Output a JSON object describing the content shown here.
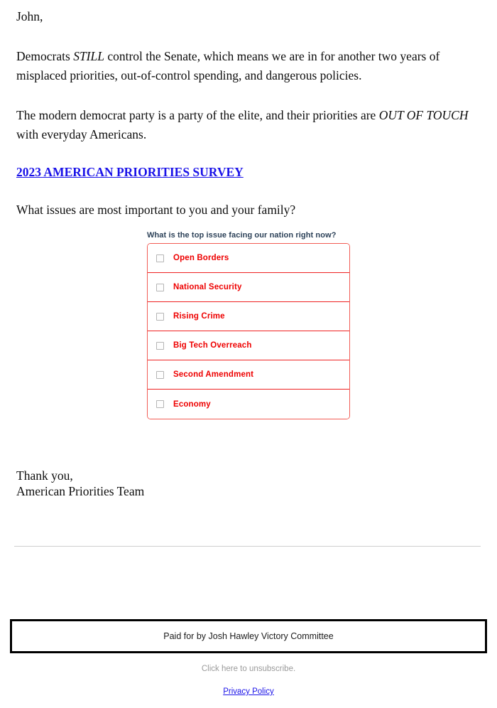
{
  "email": {
    "greeting": "John,",
    "paragraph_1_part_1": "Democrats ",
    "paragraph_1_emphasis": "STILL",
    "paragraph_1_part_2": " control the Senate, which means we are in for another two years of misplaced priorities, out-of-control spending, and dangerous policies.",
    "paragraph_2_part_1": "The modern democrat party is a party of the elite, and their priorities are ",
    "paragraph_2_emphasis": "OUT OF TOUCH",
    "paragraph_2_part_2": " with everyday Americans.",
    "survey_link_label": "2023 AMERICAN PRIORITIES SURVEY",
    "question_line": "What issues are most important to you and your family?",
    "signoff_line_1": "Thank you,",
    "signoff_line_2": "American Priorities Team"
  },
  "survey": {
    "question": "What is the top issue facing our nation right now?",
    "options": [
      {
        "label": "Open Borders",
        "checked": false
      },
      {
        "label": "National Security",
        "checked": false
      },
      {
        "label": "Rising Crime",
        "checked": false
      },
      {
        "label": "Big Tech Overreach",
        "checked": false
      },
      {
        "label": "Second Amendment",
        "checked": false
      },
      {
        "label": "Economy",
        "checked": false
      }
    ]
  },
  "footer": {
    "disclaimer": "Paid for by Josh Hawley Victory Committee",
    "unsubscribe": "Click here to unsubscribe.",
    "privacy_policy": "Privacy Policy"
  },
  "colors": {
    "link_blue": "#1a12e8",
    "option_red": "#ee0000",
    "survey_border_red": "#f25c54",
    "question_navy": "#2c4158",
    "unsubscribe_gray": "#9a9a9a",
    "divider_gray": "#cfcfcf",
    "disclaimer_border": "#000000"
  }
}
